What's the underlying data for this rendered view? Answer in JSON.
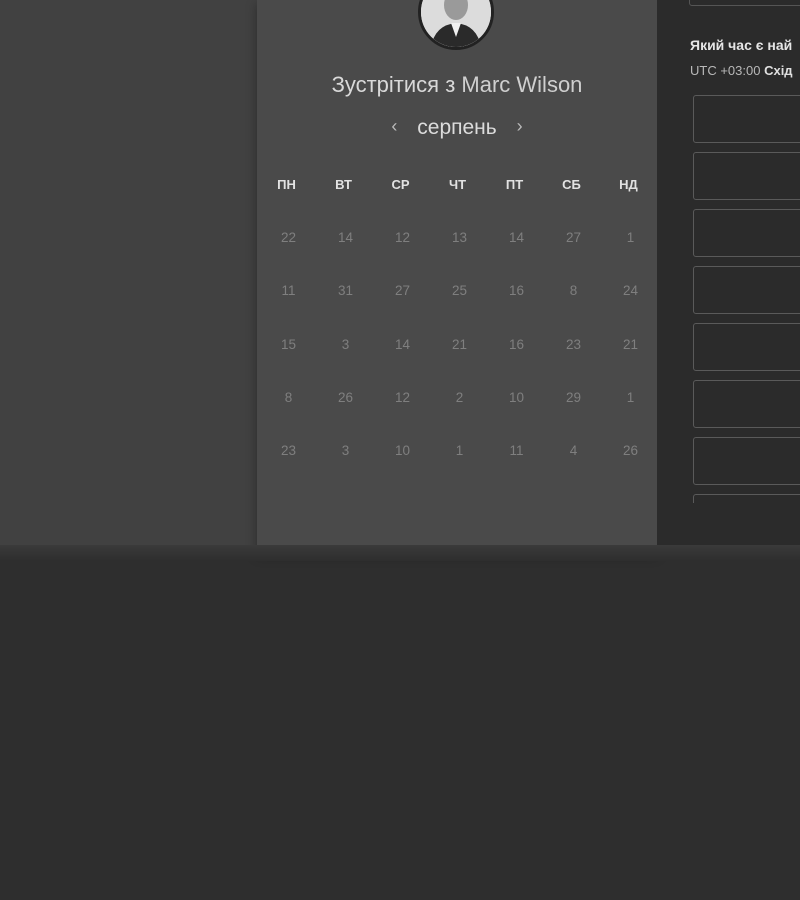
{
  "meeting": {
    "title_prefix": "Зустрітися з",
    "host_name": "Marc Wilson"
  },
  "calendar": {
    "month": "серпень",
    "prev_icon": "chevron-left-icon",
    "next_icon": "chevron-right-icon",
    "weekdays": [
      "ПН",
      "ВТ",
      "СР",
      "ЧТ",
      "ПТ",
      "СБ",
      "НД"
    ],
    "weeks": [
      [
        "22",
        "14",
        "12",
        "13",
        "14",
        "27",
        "1"
      ],
      [
        "11",
        "31",
        "27",
        "25",
        "16",
        "8",
        "24"
      ],
      [
        "15",
        "3",
        "14",
        "21",
        "16",
        "23",
        "21"
      ],
      [
        "8",
        "26",
        "12",
        "2",
        "10",
        "29",
        "1"
      ],
      [
        "23",
        "3",
        "10",
        "1",
        "11",
        "4",
        "26"
      ]
    ]
  },
  "time_panel": {
    "question": "Який час є най",
    "timezone_offset": "UTC +03:00",
    "timezone_name": "Схід",
    "slot_count_visible": 8
  },
  "colors": {
    "page_bg": "#2e2e2e",
    "card_bg": "#4a4a4a",
    "panel_bg": "#2b2b2b"
  }
}
